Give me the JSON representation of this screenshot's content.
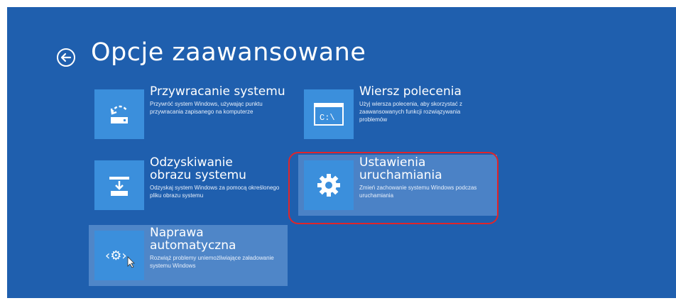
{
  "header": {
    "title": "Opcje zaawansowane"
  },
  "tiles": [
    {
      "title": "Przywracanie systemu",
      "description": "Przywróć system Windows, używając punktu przywracania zapisanego na komputerze",
      "icon": "system-restore-icon"
    },
    {
      "title": "Wiersz polecenia",
      "description": "Użyj wiersza polecenia, aby skorzystać z zaawansowanych funkcji rozwiązywania problemów",
      "icon": "command-prompt-icon",
      "icon_text": "C:\\"
    },
    {
      "title": "Odzyskiwanie obrazu systemu",
      "description": "Odzyskaj system Windows za pomocą określonego pliku obrazu systemu",
      "icon": "system-image-icon"
    },
    {
      "title": "Ustawienia uruchamiania",
      "description": "Zmień zachowanie systemu Windows podczas uruchamiania",
      "icon": "gear-icon"
    },
    {
      "title": "Naprawa automatyczna",
      "description": "Rozwiąż problemy uniemożliwiające załadowanie systemu Windows",
      "icon": "automatic-repair-icon",
      "icon_text": "‹⚙›"
    }
  ],
  "colors": {
    "background": "#1f5fae",
    "tile_icon": "#3b8fdc",
    "selected_tile": "#4b82c6",
    "highlight": "#e0252a"
  }
}
